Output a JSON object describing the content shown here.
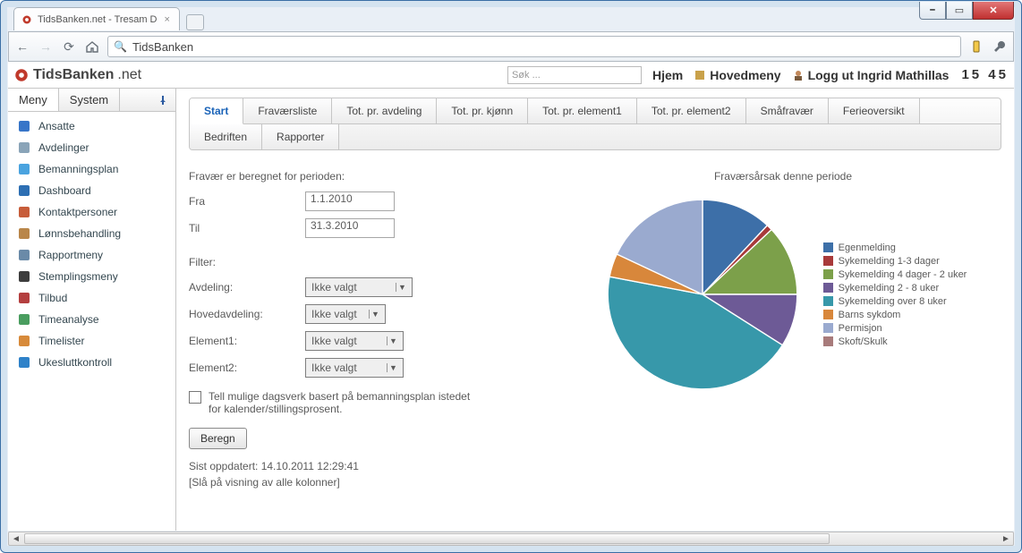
{
  "browser": {
    "tab_title": "TidsBanken.net - Tresam D",
    "omnibox_value": "TidsBanken"
  },
  "header": {
    "brand_bold": "TidsBanken",
    "brand_rest": ".net",
    "search_placeholder": "Søk ...",
    "links": {
      "home": "Hjem",
      "mainmenu": "Hovedmeny",
      "logout": "Logg ut Ingrid Mathillas"
    },
    "clock": "15 45"
  },
  "sidebar": {
    "tabs": {
      "menu": "Meny",
      "system": "System"
    },
    "items": [
      {
        "label": "Ansatte",
        "icon": "#3775c8",
        "name": "sidebar-item-ansatte"
      },
      {
        "label": "Avdelinger",
        "icon": "#8aa4b8",
        "name": "sidebar-item-avdelinger"
      },
      {
        "label": "Bemanningsplan",
        "icon": "#4aa3df",
        "name": "sidebar-item-bemanningsplan"
      },
      {
        "label": "Dashboard",
        "icon": "#2d6fb3",
        "name": "sidebar-item-dashboard"
      },
      {
        "label": "Kontaktpersoner",
        "icon": "#c75d3a",
        "name": "sidebar-item-kontaktpersoner"
      },
      {
        "label": "Lønnsbehandling",
        "icon": "#b9864a",
        "name": "sidebar-item-lonnsbehandling"
      },
      {
        "label": "Rapportmeny",
        "icon": "#6a8aa8",
        "name": "sidebar-item-rapportmeny"
      },
      {
        "label": "Stemplingsmeny",
        "icon": "#3d3d3d",
        "name": "sidebar-item-stemplingsmeny"
      },
      {
        "label": "Tilbud",
        "icon": "#b43f3f",
        "name": "sidebar-item-tilbud"
      },
      {
        "label": "Timeanalyse",
        "icon": "#4a9d5f",
        "name": "sidebar-item-timeanalyse"
      },
      {
        "label": "Timelister",
        "icon": "#d78a3a",
        "name": "sidebar-item-timelister"
      },
      {
        "label": "Ukesluttkontroll",
        "icon": "#2f82c9",
        "name": "sidebar-item-ukesluttkontroll"
      }
    ]
  },
  "content_tabs": {
    "row1": [
      "Start",
      "Fraværsliste",
      "Tot. pr. avdeling",
      "Tot. pr. kjønn",
      "Tot. pr. element1",
      "Tot. pr. element2",
      "Småfravær",
      "Ferieoversikt"
    ],
    "row2": [
      "Bedriften",
      "Rapporter"
    ],
    "active": "Start"
  },
  "form": {
    "period_title": "Fravær er beregnet for perioden:",
    "from_label": "Fra",
    "from_value": "1.1.2010",
    "to_label": "Til",
    "to_value": "31.3.2010",
    "filter_title": "Filter:",
    "avdeling_label": "Avdeling:",
    "avdeling_value": "Ikke valgt",
    "hoved_label": "Hovedavdeling:",
    "hoved_value": "Ikke valgt",
    "el1_label": "Element1:",
    "el1_value": "Ikke valgt",
    "el2_label": "Element2:",
    "el2_value": "Ikke valgt",
    "checkbox_text": "Tell mulige dagsverk basert på bemanningsplan istedet for kalender/stillingsprosent.",
    "button": "Beregn",
    "updated": "Sist oppdatert: 14.10.2011 12:29:41",
    "columns_link": "[Slå på visning av alle kolonner]"
  },
  "chart_data": {
    "type": "pie",
    "title": "Fraværsårsak denne periode",
    "series": [
      {
        "name": "Egenmelding",
        "value": 12,
        "color": "#3d6fa8"
      },
      {
        "name": "Sykemelding 1-3 dager",
        "value": 1,
        "color": "#a83a3a"
      },
      {
        "name": "Sykemelding 4 dager - 2 uker",
        "value": 12,
        "color": "#7ca04a"
      },
      {
        "name": "Sykemelding 2 - 8 uker",
        "value": 9,
        "color": "#6d5a96"
      },
      {
        "name": "Sykemelding over 8 uker",
        "value": 44,
        "color": "#3798aa"
      },
      {
        "name": "Barns sykdom",
        "value": 4,
        "color": "#d8873b"
      },
      {
        "name": "Permisjon",
        "value": 18,
        "color": "#9aaacf"
      },
      {
        "name": "Skoft/Skulk",
        "value": 0,
        "color": "#a87b7b"
      }
    ]
  }
}
